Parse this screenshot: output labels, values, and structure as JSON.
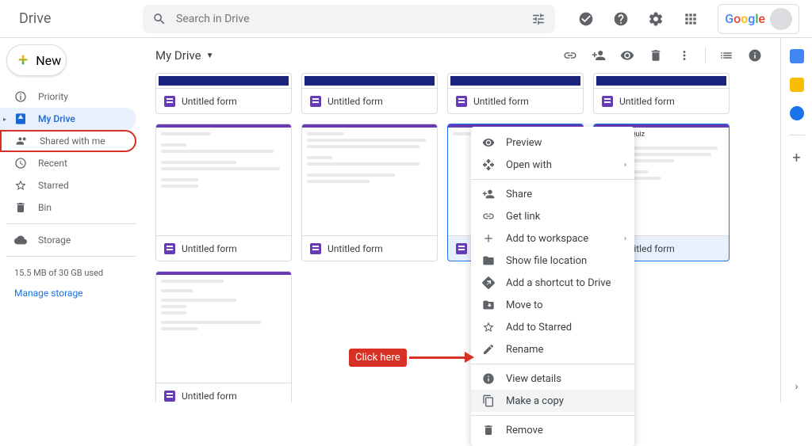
{
  "header": {
    "app_name": "Drive",
    "search_placeholder": "Search in Drive"
  },
  "sidebar": {
    "new_label": "New",
    "items": [
      {
        "label": "Priority",
        "icon": "priority"
      },
      {
        "label": "My Drive",
        "icon": "drive",
        "active": true
      },
      {
        "label": "Shared with me",
        "icon": "shared",
        "highlighted": true
      },
      {
        "label": "Recent",
        "icon": "recent"
      },
      {
        "label": "Starred",
        "icon": "star"
      },
      {
        "label": "Bin",
        "icon": "trash"
      },
      {
        "label": "Storage",
        "icon": "storage"
      }
    ],
    "storage_used": "15.5 MB of 30 GB used",
    "manage_storage": "Manage storage"
  },
  "breadcrumb": {
    "label": "My Drive"
  },
  "files": [
    {
      "name": "Untitled form",
      "preview": "dark"
    },
    {
      "name": "Untitled form",
      "preview": "dark"
    },
    {
      "name": "Untitled form",
      "preview": "dark"
    },
    {
      "name": "Untitled form",
      "preview": "dark"
    },
    {
      "name": "Untitled form",
      "preview": "lines"
    },
    {
      "name": "Untitled form",
      "preview": "lines"
    },
    {
      "name": "Untitled form",
      "preview": "lines",
      "selected": true
    },
    {
      "name": "Untitled form",
      "preview": "wellness",
      "title": "Wellness Quiz",
      "selected": true
    },
    {
      "name": "Untitled form",
      "preview": "lines"
    }
  ],
  "context_menu": {
    "items": [
      {
        "label": "Preview",
        "icon": "eye"
      },
      {
        "label": "Open with",
        "icon": "open",
        "submenu": true
      },
      {
        "divider": true
      },
      {
        "label": "Share",
        "icon": "share"
      },
      {
        "label": "Get link",
        "icon": "link"
      },
      {
        "label": "Add to workspace",
        "icon": "add",
        "submenu": true
      },
      {
        "label": "Show file location",
        "icon": "folder"
      },
      {
        "label": "Add a shortcut to Drive",
        "icon": "shortcut"
      },
      {
        "label": "Move to",
        "icon": "move"
      },
      {
        "label": "Add to Starred",
        "icon": "star"
      },
      {
        "label": "Rename",
        "icon": "rename"
      },
      {
        "divider": true
      },
      {
        "label": "View details",
        "icon": "info"
      },
      {
        "label": "Make a copy",
        "icon": "copy",
        "hovered": true
      },
      {
        "divider": true
      },
      {
        "label": "Remove",
        "icon": "trash"
      }
    ]
  },
  "callout": {
    "text": "Click here"
  },
  "google_logo": "Google"
}
